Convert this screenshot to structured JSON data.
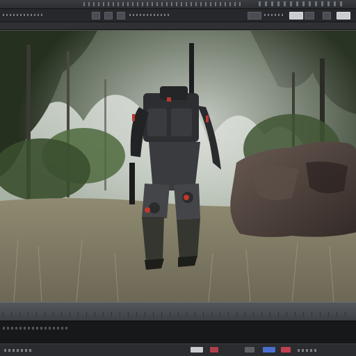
{
  "window": {
    "title": ""
  },
  "viewport": {
    "scene": "forest-clearing-armored-soldier",
    "colors": {
      "sky": "#c8cfc9",
      "foliage_dark": "#2f3a2a",
      "foliage_mid": "#4d5d3f",
      "grass": "#9a9277",
      "grass_dark": "#6e6a55",
      "armor": "#2b2c2e",
      "accent_red": "#c0392b",
      "rock": "#4a3f3a"
    }
  },
  "toolbar": {
    "buttons": [
      "toolbar-button",
      "toolbar-button",
      "toolbar-button",
      "toolbar-button",
      "toolbar-button"
    ]
  },
  "statusbar": {
    "accent_colors": [
      "#c8cbd0",
      "#b0404a",
      "#4a6fd0",
      "#c04050"
    ]
  }
}
